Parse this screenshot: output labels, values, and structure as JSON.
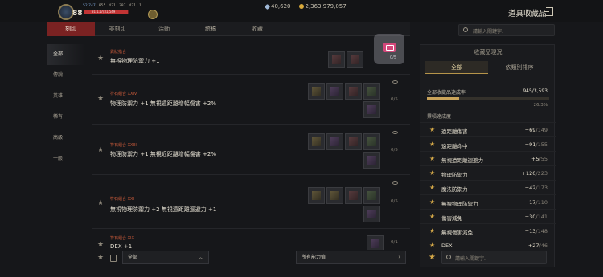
{
  "header": {
    "level": "88",
    "hp_text": "31,117/31,549",
    "hp_fraction": 0.986,
    "stats": [
      "52,747",
      "855",
      "421",
      "387",
      "421",
      "1"
    ],
    "currency": [
      {
        "icon": "gem-icon",
        "value": "40,620"
      },
      {
        "icon": "gold-coin-icon",
        "value": "2,363,979,057"
      }
    ],
    "window_title": "道具收藏品"
  },
  "tabs": [
    "刻印",
    "非刻印",
    "活動",
    "統稿",
    "收藏"
  ],
  "search_placeholder": "請輸入關鍵字.",
  "sidebar": [
    "全部",
    "傳說",
    "英雄",
    "稀有",
    "高級",
    "一般"
  ],
  "items": [
    {
      "category": "異狀指合一",
      "effect": "無視物理防禦力 +1",
      "count": "0/5"
    },
    {
      "category": "符石組合 XXIV",
      "effect": "物理防禦力 +1 無視遠距離增幅傷害 +2%",
      "count": "0/5"
    },
    {
      "category": "符石組合 XXIII",
      "effect": "物理防禦力 +1 無視近距離增幅傷害 +2%",
      "count": "0/5"
    },
    {
      "category": "符石組合 XXI",
      "effect": "無視物理防禦力 +2 無視遠距離迴避力 +1",
      "count": "0/5"
    },
    {
      "category": "符石組合 XIX",
      "effect": "DEX +1",
      "count": "0/1"
    }
  ],
  "badge_count": "0/5",
  "bottom": {
    "filter_all": "全部",
    "filter_ability": "所有能力值"
  },
  "panel": {
    "title": "收藏品現況",
    "tabs": [
      "全部",
      "依類別排序"
    ],
    "progress_label": "全部收藏品達成率",
    "progress_value": "945/3,593",
    "progress_fraction": 0.263,
    "progress_percent": "26.3%",
    "cumulative_label": "累積達成度",
    "stats": [
      {
        "name": "遠距離傷害",
        "cur": "+69",
        "max": "/149"
      },
      {
        "name": "遠距離命中",
        "cur": "+91",
        "max": "/155"
      },
      {
        "name": "無視遠距離迴避力",
        "cur": "+5",
        "max": "/55"
      },
      {
        "name": "物理防禦力",
        "cur": "+120",
        "max": "/223"
      },
      {
        "name": "魔法防禦力",
        "cur": "+42",
        "max": "/173"
      },
      {
        "name": "無視物理防禦力",
        "cur": "+17",
        "max": "/110"
      },
      {
        "name": "傷害減免",
        "cur": "+30",
        "max": "/141"
      },
      {
        "name": "無視傷害減免",
        "cur": "+13",
        "max": "/148"
      },
      {
        "name": "DEX",
        "cur": "+27",
        "max": "/46"
      }
    ],
    "search_placeholder": "請輸入關鍵字."
  }
}
